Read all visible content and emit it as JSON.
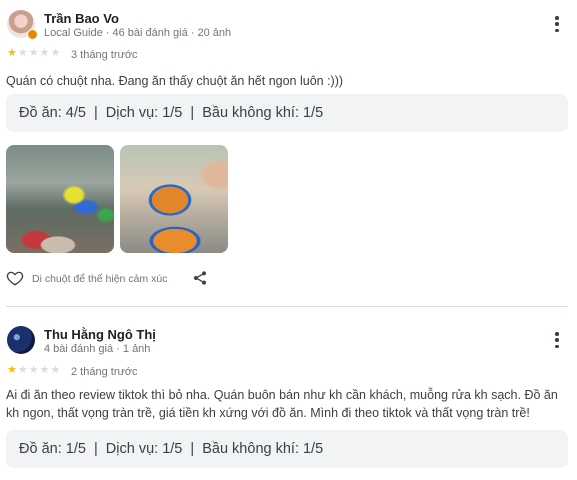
{
  "reviews": [
    {
      "name": "Trần Bao Vo",
      "meta": "Local Guide · 46 bài đánh giá · 20 ảnh",
      "rating": 1,
      "max_rating": 5,
      "date": "3 tháng trước",
      "text": "Quán có chuột nha. Đang ăn thấy chuột ăn hết ngon luôn :)))",
      "ratings_line": "Đồ ăn: 4/5  |  Dịch vụ: 1/5  |  Bầu không khí: 1/5",
      "photos": [
        "kitchen-photo",
        "food-photo"
      ],
      "like_hint": "Di chuột để thể hiện cảm xúc"
    },
    {
      "name": "Thu Hằng Ngô Thị",
      "meta": "4 bài đánh giá · 1 ảnh",
      "rating": 1,
      "max_rating": 5,
      "date": "2 tháng trước",
      "text": "Ai đi ăn theo review tiktok thì bỏ nha. Quán buôn bán như kh cần khách, muỗng rửa kh sạch. Đồ ăn kh ngon, thất vọng tràn trề, giá tiền kh xứng với đồ ăn. Mình đi theo tiktok và thất vọng tràn trề!",
      "ratings_line": "Đồ ăn: 1/5  |  Dịch vụ: 1/5  |  Bầu không khí: 1/5"
    }
  ],
  "icons": {
    "more": "more-vert-icon",
    "star": "star-icon",
    "heart": "heart-outline-icon",
    "share": "share-icon"
  },
  "colors": {
    "star_filled": "#fbbc04",
    "star_empty": "#dadce0",
    "rating_box_bg": "#f1f3f4",
    "local_guide_badge": "#ea8600"
  }
}
